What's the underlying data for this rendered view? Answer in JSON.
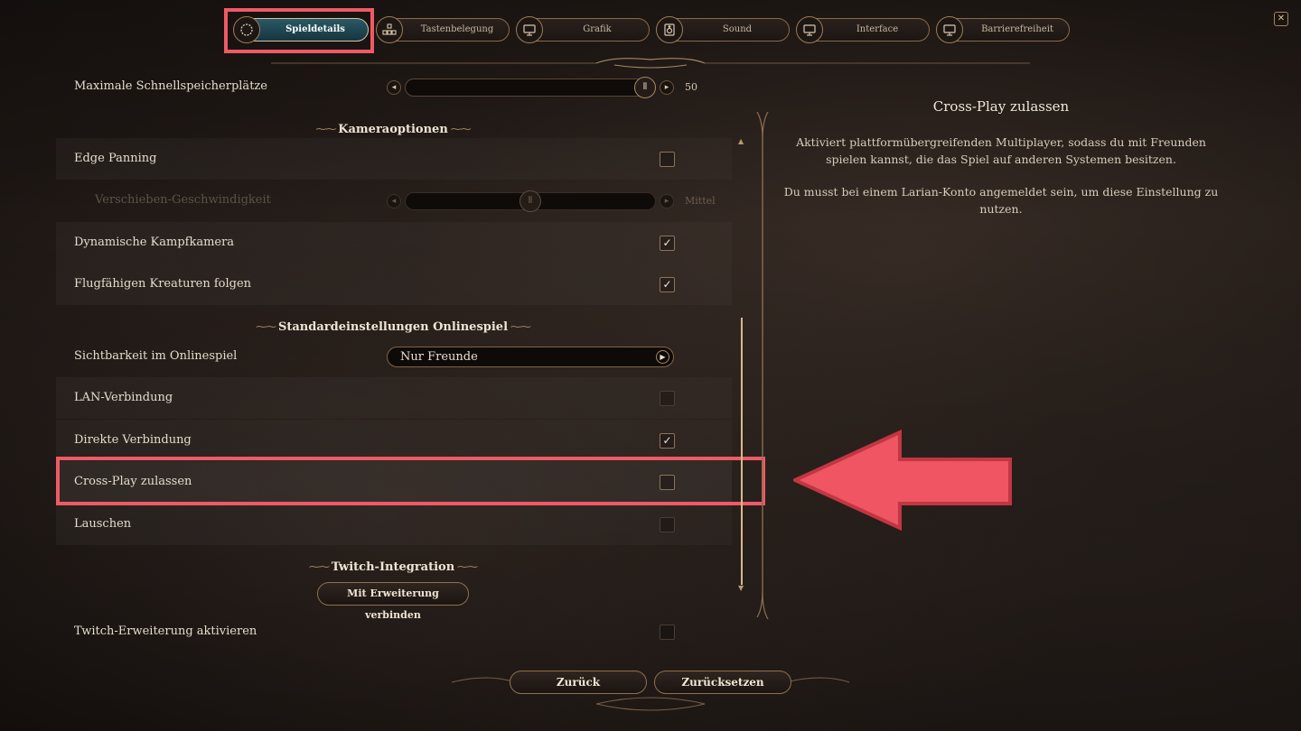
{
  "tabs": [
    {
      "label": "Spieldetails",
      "icon": "gear-icon",
      "active": true
    },
    {
      "label": "Tastenbelegung",
      "icon": "keyboard-icon",
      "active": false
    },
    {
      "label": "Grafik",
      "icon": "monitor-icon",
      "active": false
    },
    {
      "label": "Sound",
      "icon": "speaker-icon",
      "active": false
    },
    {
      "label": "Interface",
      "icon": "monitor-icon",
      "active": false
    },
    {
      "label": "Barrierefreiheit",
      "icon": "monitor-icon",
      "active": false
    }
  ],
  "settings": {
    "quicksave": {
      "label": "Maximale Schnellspeicherplätze",
      "value": "50"
    },
    "camera_section": "Kameraoptionen",
    "edge_panning": {
      "label": "Edge Panning",
      "checked": false
    },
    "pan_speed": {
      "label": "Verschieben-Geschwindigkeit",
      "value": "Mittel",
      "disabled": true
    },
    "dynamic_camera": {
      "label": "Dynamische Kampfkamera",
      "checked": true
    },
    "follow_flying": {
      "label": "Flugfähigen Kreaturen folgen",
      "checked": true
    },
    "online_section": "Standardeinstellungen Onlinespiel",
    "visibility": {
      "label": "Sichtbarkeit im Onlinespiel",
      "value": "Nur Freunde"
    },
    "lan": {
      "label": "LAN-Verbindung",
      "checked": false
    },
    "direct": {
      "label": "Direkte Verbindung",
      "checked": true
    },
    "crossplay": {
      "label": "Cross-Play zulassen",
      "checked": false
    },
    "listen": {
      "label": "Lauschen",
      "checked": false
    },
    "twitch_section": "Twitch-Integration",
    "twitch_connect": "Mit Erweiterung verbinden",
    "twitch_enable": {
      "label": "Twitch-Erweiterung aktivieren",
      "checked": false
    }
  },
  "info": {
    "title": "Cross-Play zulassen",
    "paragraph1": "Aktiviert plattformübergreifenden Multiplayer, sodass du mit Freunden spielen kannst, die das Spiel auf anderen Systemen besitzen.",
    "paragraph2": "Du musst bei einem Larian-Konto angemeldet sein, um diese Einstellung zu nutzen."
  },
  "footer": {
    "back": "Zurück",
    "reset": "Zurücksetzen"
  },
  "close_icon": "close-icon",
  "check_glyph": "✓",
  "colors": {
    "highlight": "#ee5a66",
    "active_tab": "#2a5966",
    "accent": "#d9b98f"
  }
}
